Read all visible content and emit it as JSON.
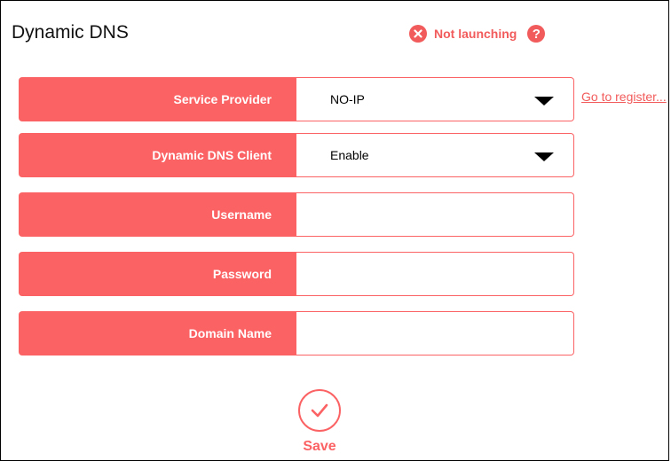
{
  "header": {
    "title": "Dynamic DNS",
    "status_text": "Not launching",
    "help_glyph": "?"
  },
  "form": {
    "rows": [
      {
        "label": "Service Provider",
        "value": "NO-IP",
        "type": "select"
      },
      {
        "label": "Dynamic DNS Client",
        "value": "Enable",
        "type": "select"
      },
      {
        "label": "Username",
        "value": "",
        "type": "input"
      },
      {
        "label": "Password",
        "value": "",
        "type": "input"
      },
      {
        "label": "Domain Name",
        "value": "",
        "type": "input"
      }
    ],
    "register_link": "Go to register..."
  },
  "actions": {
    "save_label": "Save"
  },
  "icons": {
    "status": "close-circle-icon",
    "help": "help-icon",
    "dropdown": "caret-down-icon",
    "save": "checkmark-circle-icon"
  },
  "colors": {
    "accent": "#fb6264",
    "status": "#f25b5b"
  }
}
